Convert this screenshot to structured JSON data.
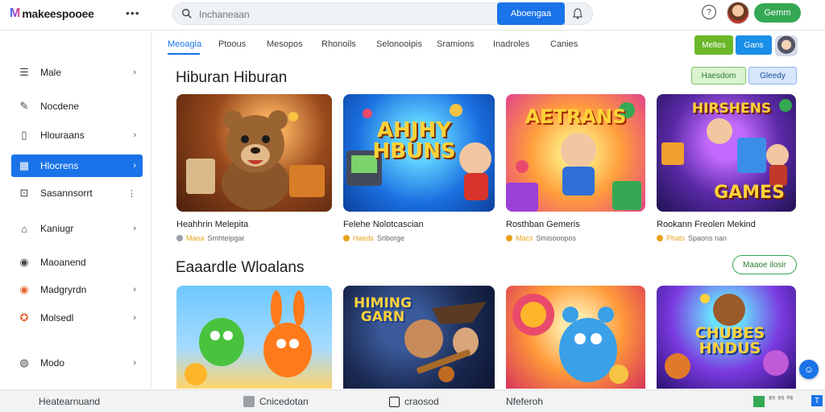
{
  "colors": {
    "accent": "#1a73e8",
    "green": "#34a853",
    "lime": "#6ab82a"
  },
  "header": {
    "logo_mark": "M",
    "logo_text": "makeespooee",
    "more_label": "•••",
    "search_placeholder": "Inchaneaan",
    "search_button": "Aboengaa",
    "help_label": "?",
    "signin_label": "Gemm"
  },
  "sidebar": {
    "items": [
      {
        "label": "Male",
        "icon": "menu-icon",
        "chevron": true,
        "active": false
      },
      {
        "label": "Nocdene",
        "icon": "edit-icon",
        "chevron": false,
        "active": false
      },
      {
        "label": "Hlouraans",
        "icon": "page-icon",
        "chevron": true,
        "active": false
      },
      {
        "label": "Hlocrens",
        "icon": "grid-icon",
        "chevron": true,
        "active": true
      },
      {
        "label": "Sasannsorrt",
        "icon": "settings-icon",
        "chevron": true,
        "active": false
      },
      {
        "label": "Kaniugr",
        "icon": "tag-icon",
        "chevron": true,
        "active": false
      },
      {
        "label": "Maoanend",
        "icon": "circle-icon",
        "chevron": false,
        "active": false
      },
      {
        "label": "Madgryrdn",
        "icon": "target-icon",
        "chevron": true,
        "active": false
      },
      {
        "label": "Molsedl",
        "icon": "star-icon",
        "chevron": true,
        "active": false
      },
      {
        "label": "Modo",
        "icon": "globe-icon",
        "chevron": true,
        "active": false
      }
    ]
  },
  "tabs": [
    "Meoagia",
    "Ptoous",
    "Mesopos",
    "Rhonoils",
    "Selonooipis",
    "Sramions",
    "Inadroles",
    "Canies"
  ],
  "chips": {
    "green": "Meltes",
    "blue": "Gans",
    "light_green": "Haesdom",
    "light_blue": "Gleedy",
    "outline": "Maaoe ilosir"
  },
  "sections": [
    {
      "title": "Hiburan Hiburan",
      "cards": [
        {
          "title": "Heahhrin Melepita",
          "tag": "Maoa",
          "meta": "Smhteipgar",
          "dot": "#9aa0a6"
        },
        {
          "title": "Felehe Nolotcascian",
          "tag": "Haeds",
          "meta": "Sriborge",
          "dot": "#e8a21a"
        },
        {
          "title": "Rosthban Gemeris",
          "tag": "Macs",
          "meta": "Smisooopos",
          "dot": "#e8a21a"
        },
        {
          "title": "Rookann Freolen Mekind",
          "tag": "Phats",
          "meta": "Spaons nan",
          "dot": "#e8a21a"
        }
      ]
    },
    {
      "title": "Eaaardle Wloalans",
      "cards": []
    }
  ],
  "thumbs": {
    "t2": "AHJHY HBUNS",
    "t3": "AETRANS",
    "t4a": "HIRSHENS",
    "t4b": "GAMES",
    "t6": "HIMING GARN",
    "t8": "CHUBES HNDUS"
  },
  "statusbar": {
    "left": "Heatearnuand",
    "item2": "Cnicedotan",
    "item3": "craosod",
    "item4": "Nfeferoh",
    "right": "⁸⁵ ⁹⁵ ⁰⁶",
    "t_icon": "T"
  },
  "fab_label": "☺"
}
